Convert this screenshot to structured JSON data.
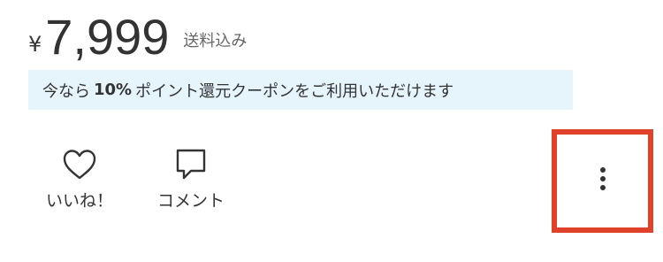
{
  "price": {
    "currency_symbol": "¥",
    "amount": "7,999",
    "shipping_note": "送料込み"
  },
  "coupon_banner": {
    "prefix": "今なら",
    "highlight": "10%",
    "suffix": "ポイント還元クーポンをご利用いただけます"
  },
  "actions": {
    "like_label": "いいね！",
    "comment_label": "コメント"
  },
  "icons": {
    "like": "heart-icon",
    "comment": "speech-bubble-icon",
    "more": "vertical-ellipsis-icon"
  },
  "colors": {
    "text": "#333333",
    "coupon_background": "#e6f4fb",
    "highlight_frame": "#e0412b"
  }
}
